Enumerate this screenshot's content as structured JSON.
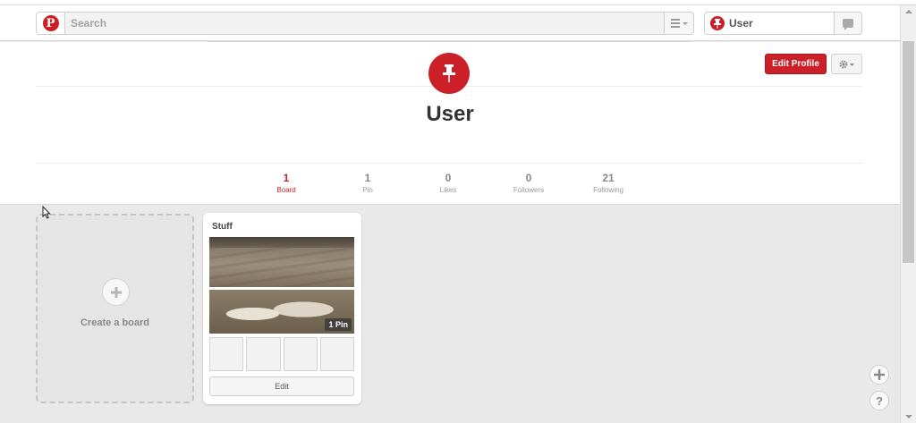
{
  "header": {
    "search_placeholder": "Search",
    "user_name": "User"
  },
  "profile": {
    "name": "User",
    "edit_profile_label": "Edit Profile",
    "stats": [
      {
        "count": "1",
        "label": "Board",
        "active": true
      },
      {
        "count": "1",
        "label": "Pin",
        "active": false
      },
      {
        "count": "0",
        "label": "Likes",
        "active": false
      },
      {
        "count": "0",
        "label": "Followers",
        "active": false
      },
      {
        "count": "21",
        "label": "Following",
        "active": false
      }
    ]
  },
  "boards": {
    "create_label": "Create a board",
    "items": [
      {
        "title": "Stuff",
        "pin_count": "1 Pin",
        "edit_label": "Edit"
      }
    ]
  },
  "colors": {
    "brand_red": "#cb2027",
    "background": "#e9e9e9"
  },
  "icons": {
    "logo": "pinterest-logo-icon",
    "menu": "hamburger-menu-icon",
    "user_avatar": "pushpin-icon",
    "notifications": "speech-bubble-icon",
    "settings": "gear-icon",
    "add": "plus-icon",
    "help": "question-mark-icon"
  }
}
